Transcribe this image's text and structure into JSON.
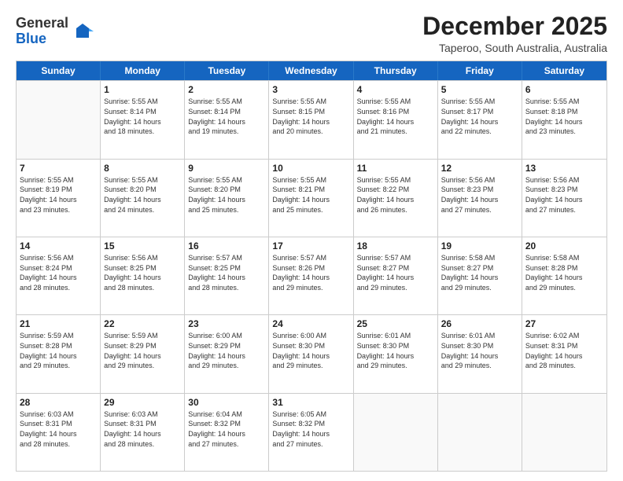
{
  "header": {
    "logo_general": "General",
    "logo_blue": "Blue",
    "main_title": "December 2025",
    "subtitle": "Taperoo, South Australia, Australia"
  },
  "calendar": {
    "days": [
      "Sunday",
      "Monday",
      "Tuesday",
      "Wednesday",
      "Thursday",
      "Friday",
      "Saturday"
    ],
    "rows": [
      [
        {
          "day": "",
          "text": ""
        },
        {
          "day": "1",
          "text": "Sunrise: 5:55 AM\nSunset: 8:14 PM\nDaylight: 14 hours\nand 18 minutes."
        },
        {
          "day": "2",
          "text": "Sunrise: 5:55 AM\nSunset: 8:14 PM\nDaylight: 14 hours\nand 19 minutes."
        },
        {
          "day": "3",
          "text": "Sunrise: 5:55 AM\nSunset: 8:15 PM\nDaylight: 14 hours\nand 20 minutes."
        },
        {
          "day": "4",
          "text": "Sunrise: 5:55 AM\nSunset: 8:16 PM\nDaylight: 14 hours\nand 21 minutes."
        },
        {
          "day": "5",
          "text": "Sunrise: 5:55 AM\nSunset: 8:17 PM\nDaylight: 14 hours\nand 22 minutes."
        },
        {
          "day": "6",
          "text": "Sunrise: 5:55 AM\nSunset: 8:18 PM\nDaylight: 14 hours\nand 23 minutes."
        }
      ],
      [
        {
          "day": "7",
          "text": "Sunrise: 5:55 AM\nSunset: 8:19 PM\nDaylight: 14 hours\nand 23 minutes."
        },
        {
          "day": "8",
          "text": "Sunrise: 5:55 AM\nSunset: 8:20 PM\nDaylight: 14 hours\nand 24 minutes."
        },
        {
          "day": "9",
          "text": "Sunrise: 5:55 AM\nSunset: 8:20 PM\nDaylight: 14 hours\nand 25 minutes."
        },
        {
          "day": "10",
          "text": "Sunrise: 5:55 AM\nSunset: 8:21 PM\nDaylight: 14 hours\nand 25 minutes."
        },
        {
          "day": "11",
          "text": "Sunrise: 5:55 AM\nSunset: 8:22 PM\nDaylight: 14 hours\nand 26 minutes."
        },
        {
          "day": "12",
          "text": "Sunrise: 5:56 AM\nSunset: 8:23 PM\nDaylight: 14 hours\nand 27 minutes."
        },
        {
          "day": "13",
          "text": "Sunrise: 5:56 AM\nSunset: 8:23 PM\nDaylight: 14 hours\nand 27 minutes."
        }
      ],
      [
        {
          "day": "14",
          "text": "Sunrise: 5:56 AM\nSunset: 8:24 PM\nDaylight: 14 hours\nand 28 minutes."
        },
        {
          "day": "15",
          "text": "Sunrise: 5:56 AM\nSunset: 8:25 PM\nDaylight: 14 hours\nand 28 minutes."
        },
        {
          "day": "16",
          "text": "Sunrise: 5:57 AM\nSunset: 8:25 PM\nDaylight: 14 hours\nand 28 minutes."
        },
        {
          "day": "17",
          "text": "Sunrise: 5:57 AM\nSunset: 8:26 PM\nDaylight: 14 hours\nand 29 minutes."
        },
        {
          "day": "18",
          "text": "Sunrise: 5:57 AM\nSunset: 8:27 PM\nDaylight: 14 hours\nand 29 minutes."
        },
        {
          "day": "19",
          "text": "Sunrise: 5:58 AM\nSunset: 8:27 PM\nDaylight: 14 hours\nand 29 minutes."
        },
        {
          "day": "20",
          "text": "Sunrise: 5:58 AM\nSunset: 8:28 PM\nDaylight: 14 hours\nand 29 minutes."
        }
      ],
      [
        {
          "day": "21",
          "text": "Sunrise: 5:59 AM\nSunset: 8:28 PM\nDaylight: 14 hours\nand 29 minutes."
        },
        {
          "day": "22",
          "text": "Sunrise: 5:59 AM\nSunset: 8:29 PM\nDaylight: 14 hours\nand 29 minutes."
        },
        {
          "day": "23",
          "text": "Sunrise: 6:00 AM\nSunset: 8:29 PM\nDaylight: 14 hours\nand 29 minutes."
        },
        {
          "day": "24",
          "text": "Sunrise: 6:00 AM\nSunset: 8:30 PM\nDaylight: 14 hours\nand 29 minutes."
        },
        {
          "day": "25",
          "text": "Sunrise: 6:01 AM\nSunset: 8:30 PM\nDaylight: 14 hours\nand 29 minutes."
        },
        {
          "day": "26",
          "text": "Sunrise: 6:01 AM\nSunset: 8:30 PM\nDaylight: 14 hours\nand 29 minutes."
        },
        {
          "day": "27",
          "text": "Sunrise: 6:02 AM\nSunset: 8:31 PM\nDaylight: 14 hours\nand 28 minutes."
        }
      ],
      [
        {
          "day": "28",
          "text": "Sunrise: 6:03 AM\nSunset: 8:31 PM\nDaylight: 14 hours\nand 28 minutes."
        },
        {
          "day": "29",
          "text": "Sunrise: 6:03 AM\nSunset: 8:31 PM\nDaylight: 14 hours\nand 28 minutes."
        },
        {
          "day": "30",
          "text": "Sunrise: 6:04 AM\nSunset: 8:32 PM\nDaylight: 14 hours\nand 27 minutes."
        },
        {
          "day": "31",
          "text": "Sunrise: 6:05 AM\nSunset: 8:32 PM\nDaylight: 14 hours\nand 27 minutes."
        },
        {
          "day": "",
          "text": ""
        },
        {
          "day": "",
          "text": ""
        },
        {
          "day": "",
          "text": ""
        }
      ]
    ]
  }
}
